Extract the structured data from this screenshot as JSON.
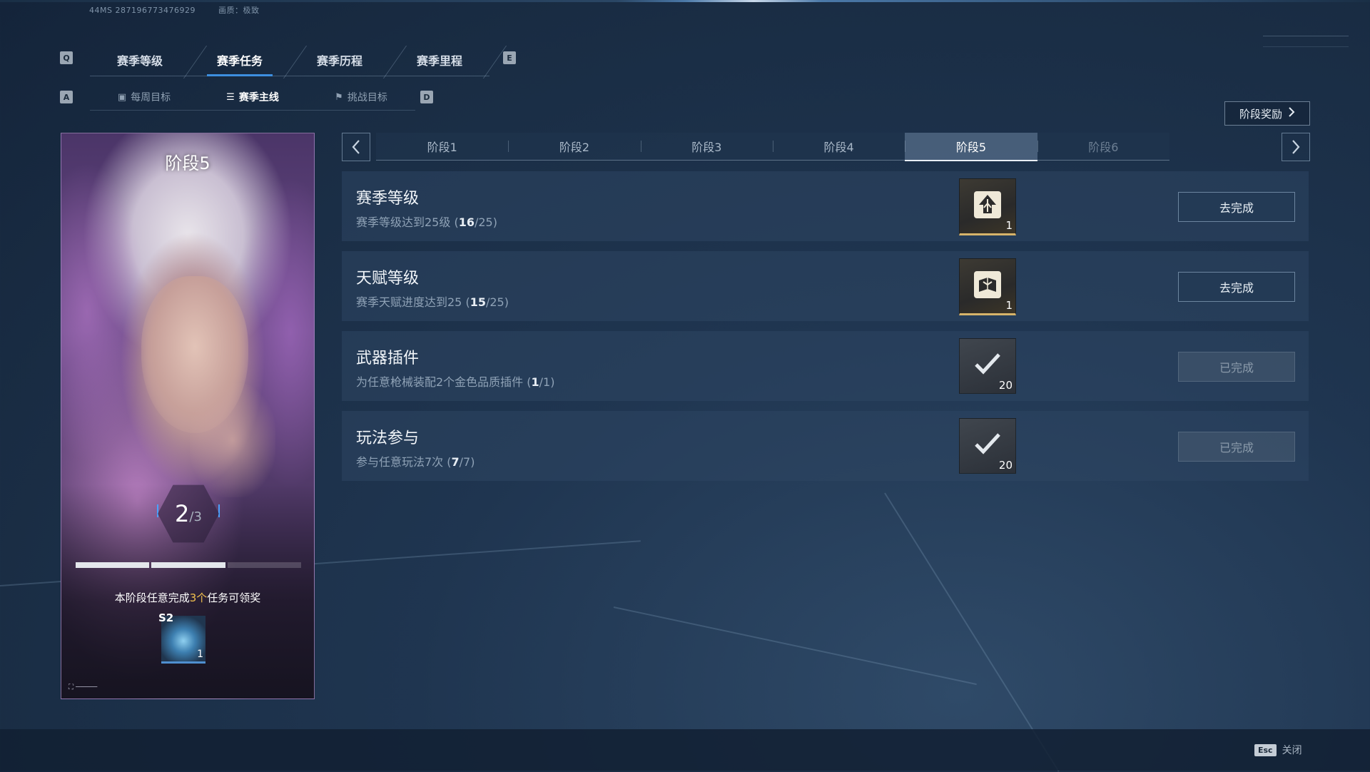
{
  "top_meta": {
    "build": "44MS  287196773476929",
    "quality": "画质：极致"
  },
  "keys": {
    "prev_tab": "Q",
    "next_tab": "E",
    "prev_sub": "A",
    "next_sub": "D",
    "esc": "Esc"
  },
  "main_tabs": [
    {
      "label": "赛季等级",
      "active": false
    },
    {
      "label": "赛季任务",
      "active": true
    },
    {
      "label": "赛季历程",
      "active": false
    },
    {
      "label": "赛季里程",
      "active": false
    }
  ],
  "sub_tabs": [
    {
      "label": "每周目标",
      "icon": "calendar-icon",
      "active": false
    },
    {
      "label": "赛季主线",
      "icon": "list-icon",
      "active": true
    },
    {
      "label": "挑战目标",
      "icon": "flag-icon",
      "active": false
    }
  ],
  "stage_reward_label": "阶段奖励",
  "card": {
    "title": "阶段5",
    "progress_current": "2",
    "progress_total": "/3",
    "progress_fraction": 0.667,
    "desc_prefix": "本阶段任意完成",
    "desc_highlight": "3个",
    "desc_suffix": "任务可领奖",
    "reward_tag": "S2",
    "reward_count": "1"
  },
  "stage_tabs": [
    {
      "label": "阶段1",
      "active": false
    },
    {
      "label": "阶段2",
      "active": false
    },
    {
      "label": "阶段3",
      "active": false
    },
    {
      "label": "阶段4",
      "active": false
    },
    {
      "label": "阶段5",
      "active": true
    },
    {
      "label": "阶段6",
      "active": false
    }
  ],
  "tasks": [
    {
      "title": "赛季等级",
      "desc": "赛季等级达到25级",
      "progress_done": "16",
      "progress_total": "25",
      "reward_icon": "season-rank-icon",
      "reward_qty": "1",
      "button": "去完成",
      "completed": false
    },
    {
      "title": "天赋等级",
      "desc": "赛季天赋进度达到25",
      "progress_done": "15",
      "progress_total": "25",
      "reward_icon": "talent-book-icon",
      "reward_qty": "1",
      "button": "去完成",
      "completed": false
    },
    {
      "title": "武器插件",
      "desc": "为任意枪械装配2个金色品质插件",
      "progress_done": "1",
      "progress_total": "1",
      "reward_icon": "check-icon",
      "reward_qty": "20",
      "button": "已完成",
      "completed": true
    },
    {
      "title": "玩法参与",
      "desc": "参与任意玩法7次",
      "progress_done": "7",
      "progress_total": "7",
      "reward_icon": "check-icon",
      "reward_qty": "20",
      "button": "已完成",
      "completed": true
    }
  ],
  "footer": {
    "close_label": "关闭"
  },
  "colors": {
    "accent": "#3d8fe0",
    "highlight": "#f2c14e",
    "gold_border": "#d7b46a"
  }
}
